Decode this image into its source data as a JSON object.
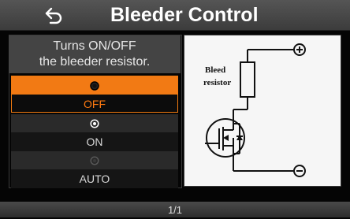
{
  "header": {
    "title": "Bleeder Control",
    "back_icon": "back-arrow-icon"
  },
  "description": {
    "line1": "Turns ON/OFF",
    "line2": "the bleeder resistor."
  },
  "options": [
    {
      "label": "OFF",
      "selected": true
    },
    {
      "label": "ON",
      "selected": false
    },
    {
      "label": "AUTO",
      "selected": false
    }
  ],
  "diagram": {
    "label_line1": "Bleed",
    "label_line2": "resistor"
  },
  "footer": {
    "page_indicator": "1/1"
  },
  "colors": {
    "accent": "#f27a14",
    "title_bar": "#4a4a4a",
    "background": "#050505"
  }
}
